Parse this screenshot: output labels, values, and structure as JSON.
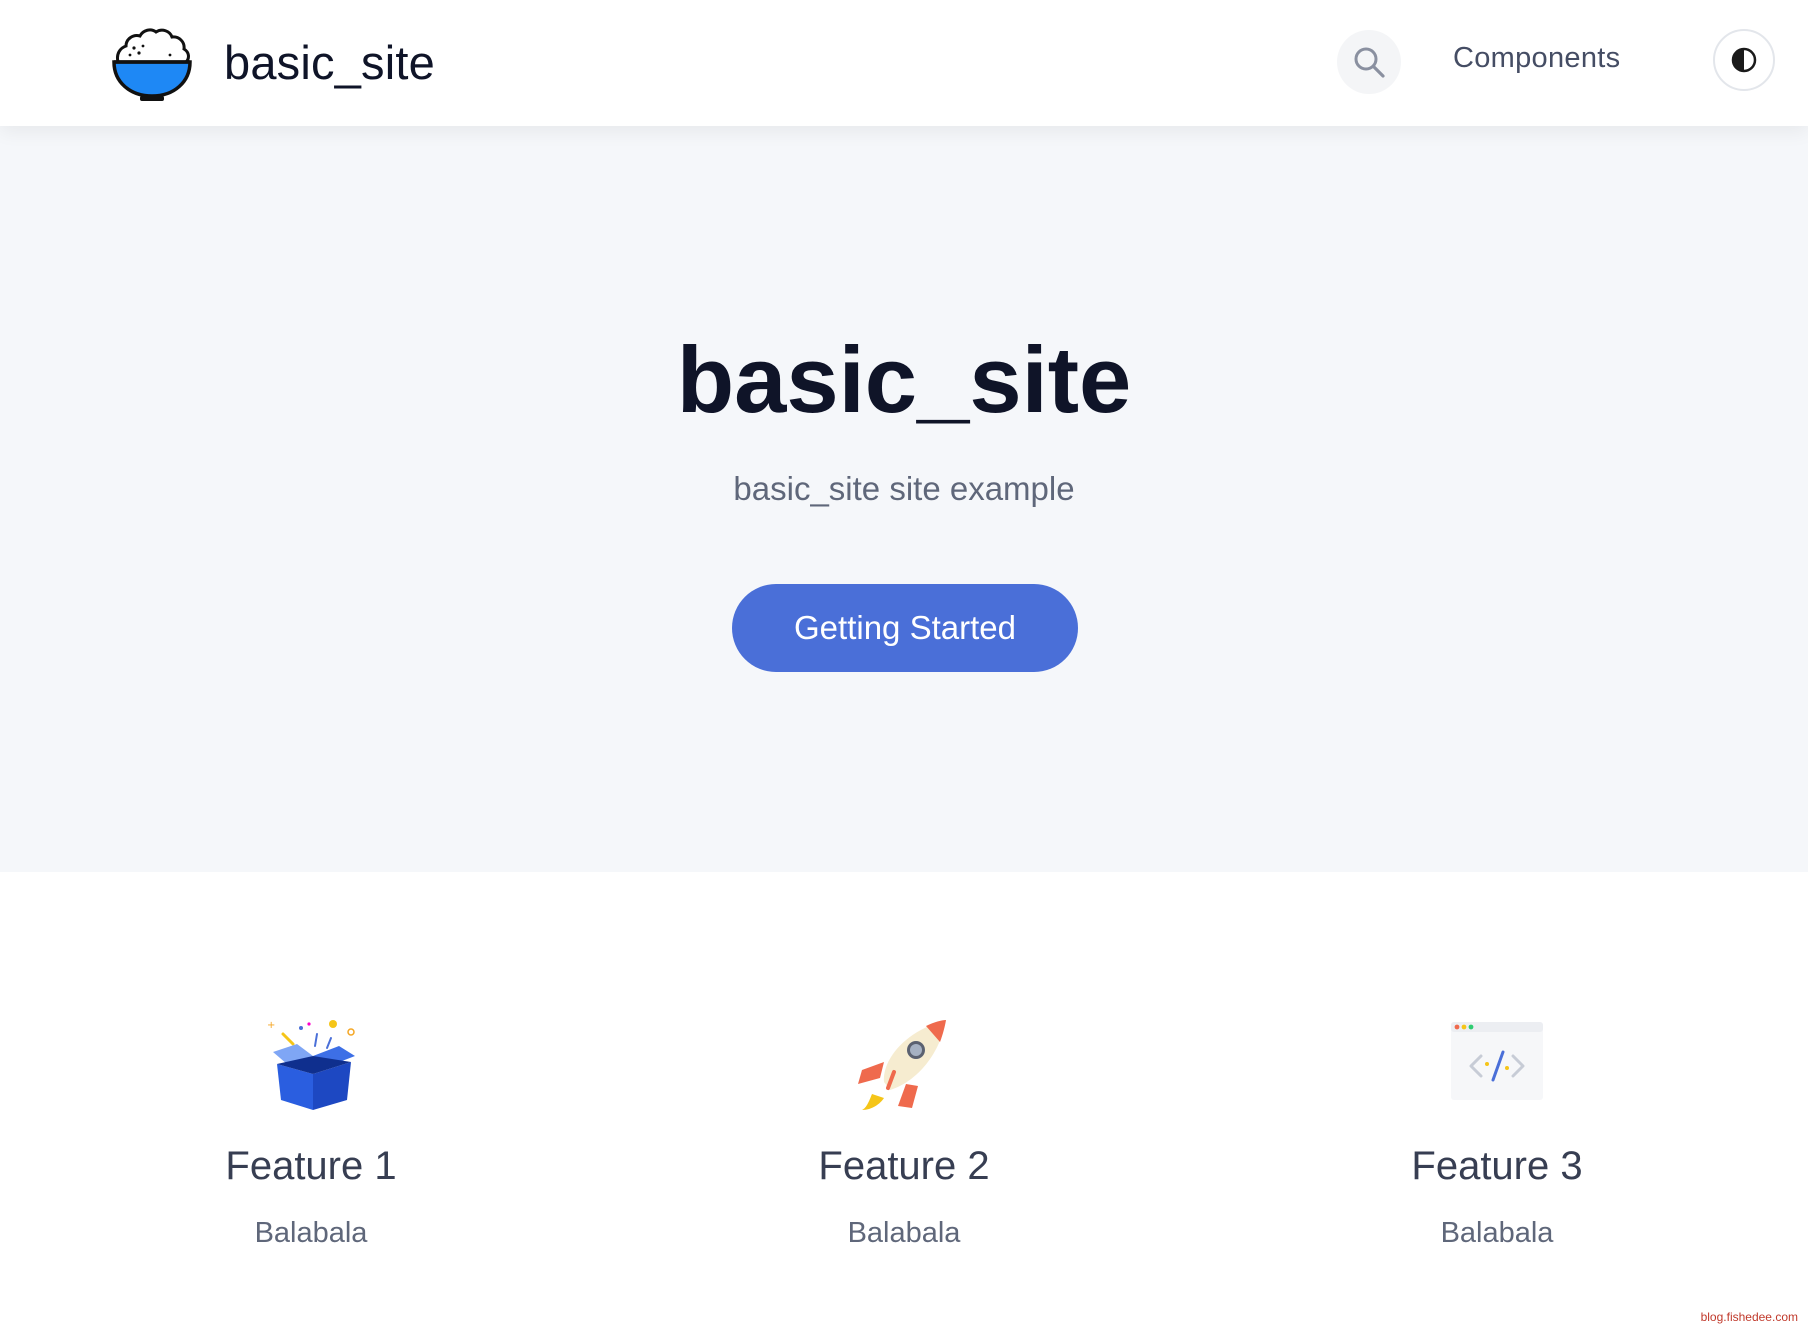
{
  "navbar": {
    "brand_title": "basic_site",
    "logo_icon": "rice-bowl-icon",
    "search_icon": "search-icon",
    "components_link": "Components",
    "theme_icon": "contrast-icon"
  },
  "hero": {
    "title": "basic_site",
    "subtitle": "basic_site site example",
    "button_label": "Getting Started"
  },
  "features": [
    {
      "icon": "gift-box-icon",
      "title": "Feature 1",
      "description": "Balabala"
    },
    {
      "icon": "rocket-icon",
      "title": "Feature 2",
      "description": "Balabala"
    },
    {
      "icon": "code-window-icon",
      "title": "Feature 3",
      "description": "Balabala"
    }
  ],
  "watermark": "blog.fishedee.com",
  "colors": {
    "accent": "#4a6fd8",
    "hero_background": "#f5f7fa",
    "heading": "#0f1428",
    "muted_text": "#5f677a"
  }
}
